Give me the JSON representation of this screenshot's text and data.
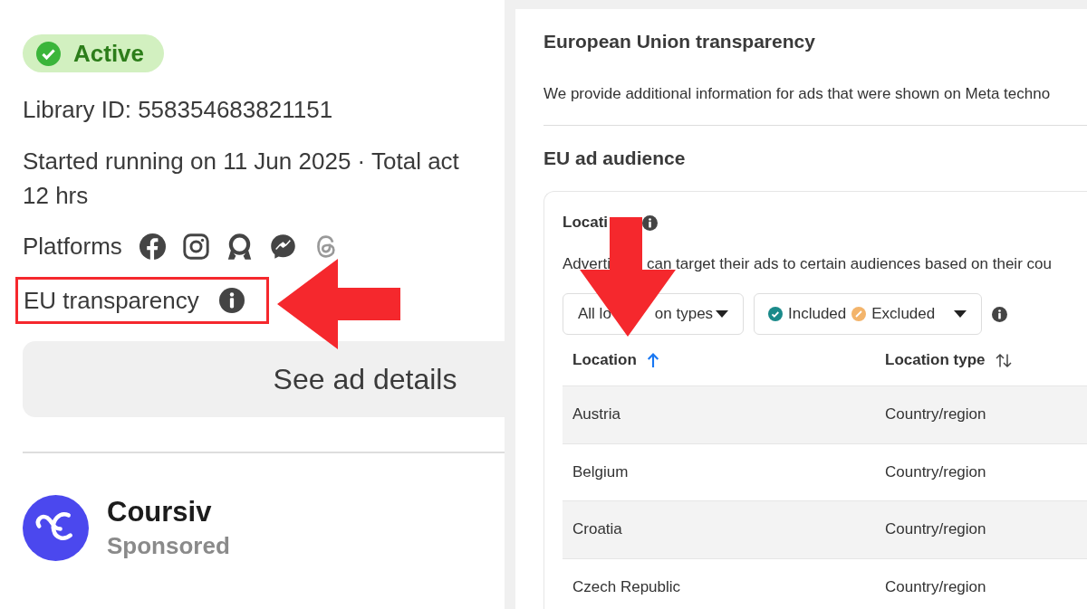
{
  "ad_summary": {
    "status": {
      "label": "Active",
      "active": true
    },
    "library_id": "Library ID: 558354683821151",
    "running_lines": [
      "Started running on 11 Jun 2025 · Total act",
      "12 hrs"
    ],
    "platforms_label": "Platforms",
    "platforms": [
      {
        "kind": "facebook"
      },
      {
        "kind": "instagram"
      },
      {
        "kind": "audience"
      },
      {
        "kind": "messenger"
      },
      {
        "kind": "threads"
      }
    ],
    "eu_transparency_label": "EU transparency",
    "details_button": "See ad details",
    "advertiser": {
      "name": "Coursiv",
      "subtitle": "Sponsored"
    }
  },
  "eu_panel": {
    "title": "European Union transparency",
    "intro": "We provide additional information for ads that were shown on Meta techno",
    "audience_title": "EU ad audience",
    "location_section": {
      "title_visible": "Locati",
      "description_parts": [
        "Adverti",
        "can target their ads to certain audiences based on their cou"
      ],
      "type_filter_parts": [
        "All lo",
        "on types"
      ],
      "status_filter": [
        {
          "label": "Included",
          "color": "#1a8a8a"
        },
        {
          "label": "Excluded",
          "color": "#f3b46b"
        }
      ],
      "columns": [
        {
          "label": "Location",
          "sorted": true
        },
        {
          "label": "Location type",
          "sorted": false
        }
      ],
      "rows": [
        {
          "location": "Austria",
          "type": "Country/region"
        },
        {
          "location": "Belgium",
          "type": "Country/region"
        },
        {
          "location": "Croatia",
          "type": "Country/region"
        },
        {
          "location": "Czech Republic",
          "type": "Country/region"
        }
      ]
    }
  }
}
